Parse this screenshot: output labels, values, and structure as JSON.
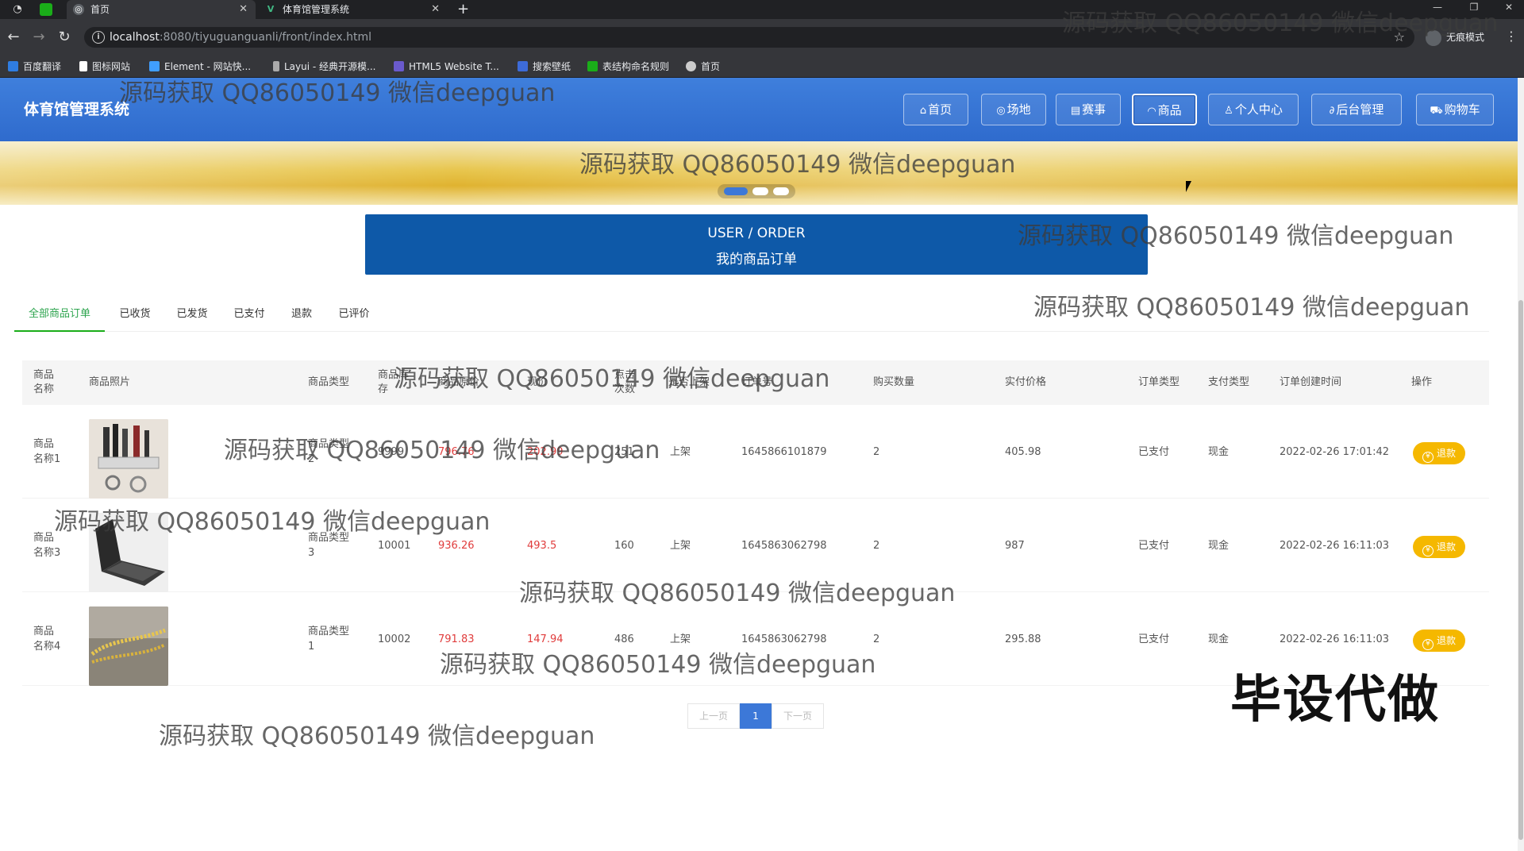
{
  "browser": {
    "tabs": [
      {
        "label": "首页"
      },
      {
        "label": "体育馆管理系统"
      }
    ],
    "url_host": "localhost",
    "url_path": ":8080/tiyuguanguanli/front/index.html",
    "incognito_label": "无痕模式",
    "bookmarks": [
      "百度翻译",
      "图标网站",
      "Element - 网站快...",
      "Layui - 经典开源模...",
      "HTML5 Website T...",
      "搜索壁纸",
      "表结构命名规则",
      "首页"
    ]
  },
  "header": {
    "site_title": "体育馆管理系统",
    "nav": [
      {
        "label": "首页",
        "icon": "home-icon"
      },
      {
        "label": "场地",
        "icon": "venue-icon"
      },
      {
        "label": "赛事",
        "icon": "calendar-icon"
      },
      {
        "label": "商品",
        "icon": "goods-icon"
      },
      {
        "label": "个人中心",
        "icon": "user-icon"
      },
      {
        "label": "后台管理",
        "icon": "link-icon"
      },
      {
        "label": "购物车",
        "icon": "cart-icon"
      }
    ],
    "active_nav": "商品"
  },
  "order_banner": {
    "en": "USER / ORDER",
    "zh": "我的商品订单"
  },
  "order_tabs": [
    "全部商品订单",
    "已收货",
    "已发货",
    "已支付",
    "退款",
    "已评价"
  ],
  "table": {
    "headers": [
      "商品\n名称",
      "商品照片",
      "商品类型",
      "商品库\n存",
      "商品原价",
      "现价",
      "点击\n次数",
      "是否上架",
      "订单号",
      "购买数量",
      "实付价格",
      "订单类型",
      "支付类型",
      "订单创建时间",
      "操作"
    ],
    "rows": [
      {
        "name": "商品\n名称1",
        "type": "商品类型\n2",
        "stock": "9999",
        "orig_price": "796.76",
        "price": "202.99",
        "clicks": "251",
        "status": "上架",
        "order_no": "1645866101879",
        "qty": "2",
        "paid": "405.98",
        "order_type": "已支付",
        "pay_type": "现金",
        "created": "2022-02-26 17:01:42",
        "action": "退款"
      },
      {
        "name": "商品\n名称3",
        "type": "商品类型\n3",
        "stock": "10001",
        "orig_price": "936.26",
        "price": "493.5",
        "clicks": "160",
        "status": "上架",
        "order_no": "1645863062798",
        "qty": "2",
        "paid": "987",
        "order_type": "已支付",
        "pay_type": "现金",
        "created": "2022-02-26 16:11:03",
        "action": "退款"
      },
      {
        "name": "商品\n名称4",
        "type": "商品类型\n1",
        "stock": "10002",
        "orig_price": "791.83",
        "price": "147.94",
        "clicks": "486",
        "status": "上架",
        "order_no": "1645863062798",
        "qty": "2",
        "paid": "295.88",
        "order_type": "已支付",
        "pay_type": "现金",
        "created": "2022-02-26 16:11:03",
        "action": "退款"
      }
    ]
  },
  "pager": {
    "prev": "上一页",
    "current": "1",
    "next": "下一页"
  },
  "watermark_text": "源码获取 QQ86050149 微信deepguan",
  "promo_text": "毕设代做",
  "colors": {
    "header": "#3c78d8",
    "order_banner": "#0e59a8",
    "active_tab": "#2da44e",
    "refund": "#f5b800",
    "price_red": "#e03c3c"
  }
}
